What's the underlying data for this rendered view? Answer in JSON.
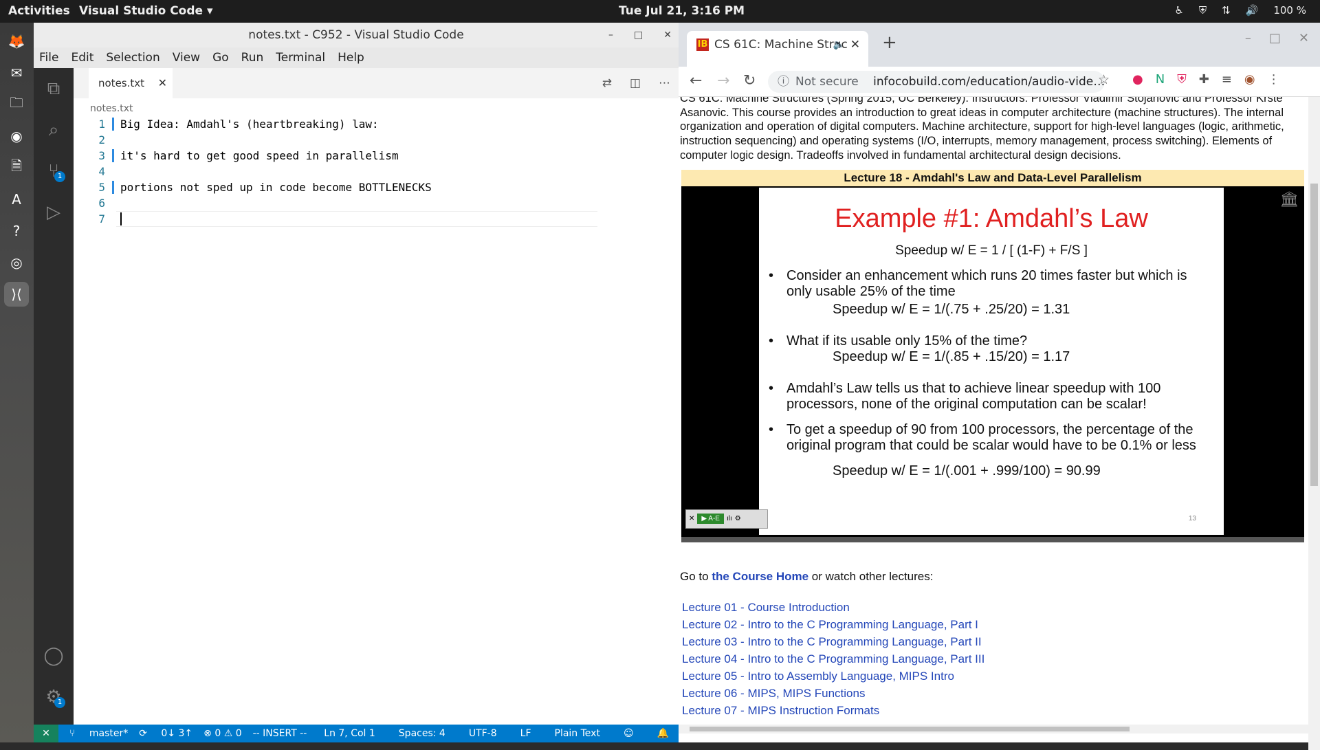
{
  "topbar": {
    "activities": "Activities",
    "app": "Visual Studio Code ▾",
    "clock": "Tue Jul 21,  3:16 PM",
    "battery": "100 %"
  },
  "vscode": {
    "window_title": "notes.txt - C952 - Visual Studio Code",
    "menu": [
      "File",
      "Edit",
      "Selection",
      "View",
      "Go",
      "Run",
      "Terminal",
      "Help"
    ],
    "tab_label": "notes.txt",
    "breadcrumb": "notes.txt",
    "lines": [
      {
        "num": "1",
        "text": "Big Idea: Amdahl's (heartbreaking) law:"
      },
      {
        "num": "2",
        "text": ""
      },
      {
        "num": "3",
        "text": "it's hard to get good speed in parallelism"
      },
      {
        "num": "4",
        "text": ""
      },
      {
        "num": "5",
        "text": "portions not sped up in code become BOTTLENECKS"
      },
      {
        "num": "6",
        "text": ""
      },
      {
        "num": "7",
        "text": ""
      }
    ],
    "scm_badge": "1",
    "settings_badge": "1",
    "status": {
      "branch": "master*",
      "sync": "0↓ 3↑",
      "problems": "⊗ 0 ⚠ 0",
      "mode": "-- INSERT --",
      "position": "Ln 7, Col 1",
      "spaces": "Spaces: 4",
      "encoding": "UTF-8",
      "eol": "LF",
      "language": "Plain Text"
    }
  },
  "browser": {
    "tab_title": "CS 61C: Machine Struc",
    "not_secure": "Not secure",
    "url": "infocobuild.com/education/audio-vide…",
    "description": "CS 61C: Machine Structures (Spring 2015, UC Berkeley). Instructors: Professor Vladimir Stojanovic and Professor Krste Asanovic. This course provides an introduction to great ideas in computer architecture (machine structures). The internal organization and operation of digital computers. Machine architecture, support for high-level languages (logic, arithmetic, instruction sequencing) and operating systems (I/O, interrupts, memory management, process switching). Elements of computer logic design. Tradeoffs involved in fundamental architectural design decisions.",
    "lecture_title": "Lecture 18 - Amdahl's Law and Data-Level Parallelism",
    "slide": {
      "title": "Example #1: Amdahl’s Law",
      "formula": "Speedup w/ E =   1 / [ (1-F) + F/S ]",
      "b1": "Consider an enhancement which runs 20 times faster but which is only usable 25% of the time",
      "s1": "Speedup w/ E  =  1/(.75 + .25/20)  =  1.31",
      "b2": "What if its usable only 15% of the time?",
      "s2": "Speedup w/ E  =  1/(.85 + .15/20)  =  1.17",
      "b3": "Amdahl’s Law tells us that to achieve linear speedup with 100 processors, none of the original computation can be scalar!",
      "b4": "To get a speedup of 90 from 100 processors, the percentage of the original program that could be scalar would have to be 0.1% or less",
      "s3": "Speedup w/ E  =  1/(.001 + .999/100)  =  90.99",
      "page": "13"
    },
    "goto_prefix": "Go to ",
    "goto_link": "the Course Home",
    "goto_suffix": " or watch other lectures:",
    "lectures": [
      "Lecture 01 - Course Introduction",
      "Lecture 02 - Intro to the C Programming Language, Part I",
      "Lecture 03 - Intro to the C Programming Language, Part II",
      "Lecture 04 - Intro to the C Programming Language, Part III",
      "Lecture 05 - Intro to Assembly Language, MIPS Intro",
      "Lecture 06 - MIPS, MIPS Functions",
      "Lecture 07 - MIPS Instruction Formats"
    ]
  }
}
